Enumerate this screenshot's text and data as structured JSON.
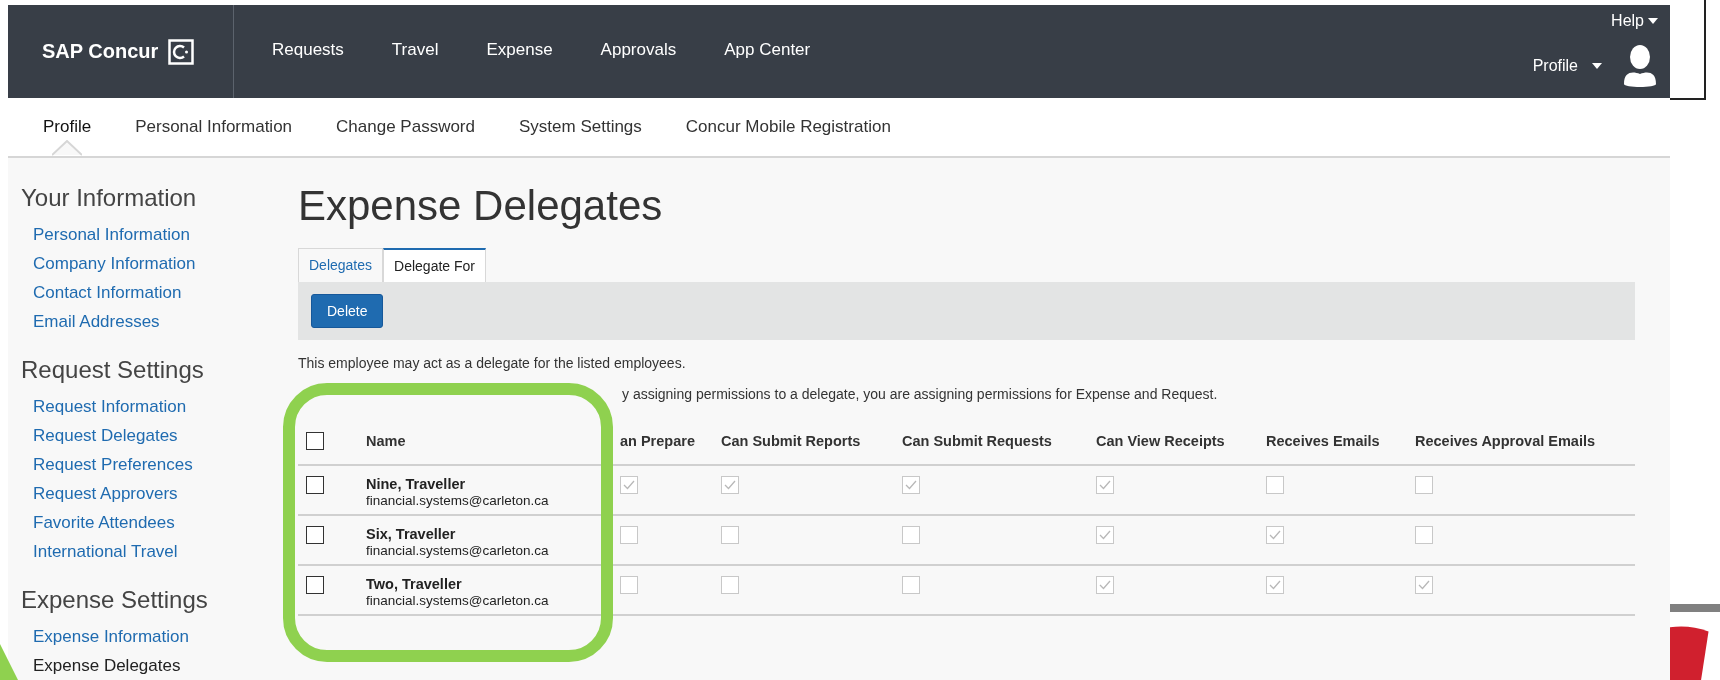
{
  "top_nav": {
    "brand": "SAP Concur",
    "items": [
      "Requests",
      "Travel",
      "Expense",
      "Approvals",
      "App Center"
    ],
    "help": "Help",
    "profile": "Profile"
  },
  "sub_nav": [
    {
      "label": "Profile",
      "selected": true
    },
    {
      "label": "Personal Information",
      "selected": false
    },
    {
      "label": "Change Password",
      "selected": false
    },
    {
      "label": "System Settings",
      "selected": false
    },
    {
      "label": "Concur Mobile Registration",
      "selected": false
    }
  ],
  "sidebar": [
    {
      "title": "Your Information",
      "items": [
        {
          "label": "Personal Information",
          "selected": false
        },
        {
          "label": "Company Information",
          "selected": false
        },
        {
          "label": "Contact Information",
          "selected": false
        },
        {
          "label": "Email Addresses",
          "selected": false
        }
      ]
    },
    {
      "title": "Request Settings",
      "items": [
        {
          "label": "Request Information",
          "selected": false
        },
        {
          "label": "Request Delegates",
          "selected": false
        },
        {
          "label": "Request Preferences",
          "selected": false
        },
        {
          "label": "Request Approvers",
          "selected": false
        },
        {
          "label": "Favorite Attendees",
          "selected": false
        },
        {
          "label": "International Travel",
          "selected": false
        }
      ]
    },
    {
      "title": "Expense Settings",
      "items": [
        {
          "label": "Expense Information",
          "selected": false
        },
        {
          "label": "Expense Delegates",
          "selected": true
        }
      ]
    }
  ],
  "page_title": "Expense Delegates",
  "tabs": [
    {
      "label": "Delegates",
      "selected": false
    },
    {
      "label": "Delegate For",
      "selected": true
    }
  ],
  "toolbar": {
    "button": "Delete"
  },
  "description": "This employee may act as a delegate for the listed employees.",
  "note_visible_part": "y assigning permissions to a delegate, you are assigning permissions for Expense and Request.",
  "table": {
    "select_all": {
      "checked": false
    },
    "columns": [
      "Name",
      "an Prepare",
      "Can Submit Reports",
      "Can Submit Requests",
      "Can View Receipts",
      "Receives Emails",
      "Receives Approval Emails"
    ],
    "rows": [
      {
        "name": "Nine, Traveller",
        "email": "financial.systems@carleton.ca",
        "checked": false,
        "permissions": [
          true,
          true,
          true,
          true,
          false,
          false
        ]
      },
      {
        "name": "Six, Traveller",
        "email": "financial.systems@carleton.ca",
        "checked": false,
        "permissions": [
          false,
          false,
          false,
          true,
          true,
          false
        ]
      },
      {
        "name": "Two, Traveller",
        "email": "financial.systems@carleton.ca",
        "checked": false,
        "permissions": [
          false,
          false,
          false,
          true,
          true,
          true
        ]
      }
    ]
  }
}
